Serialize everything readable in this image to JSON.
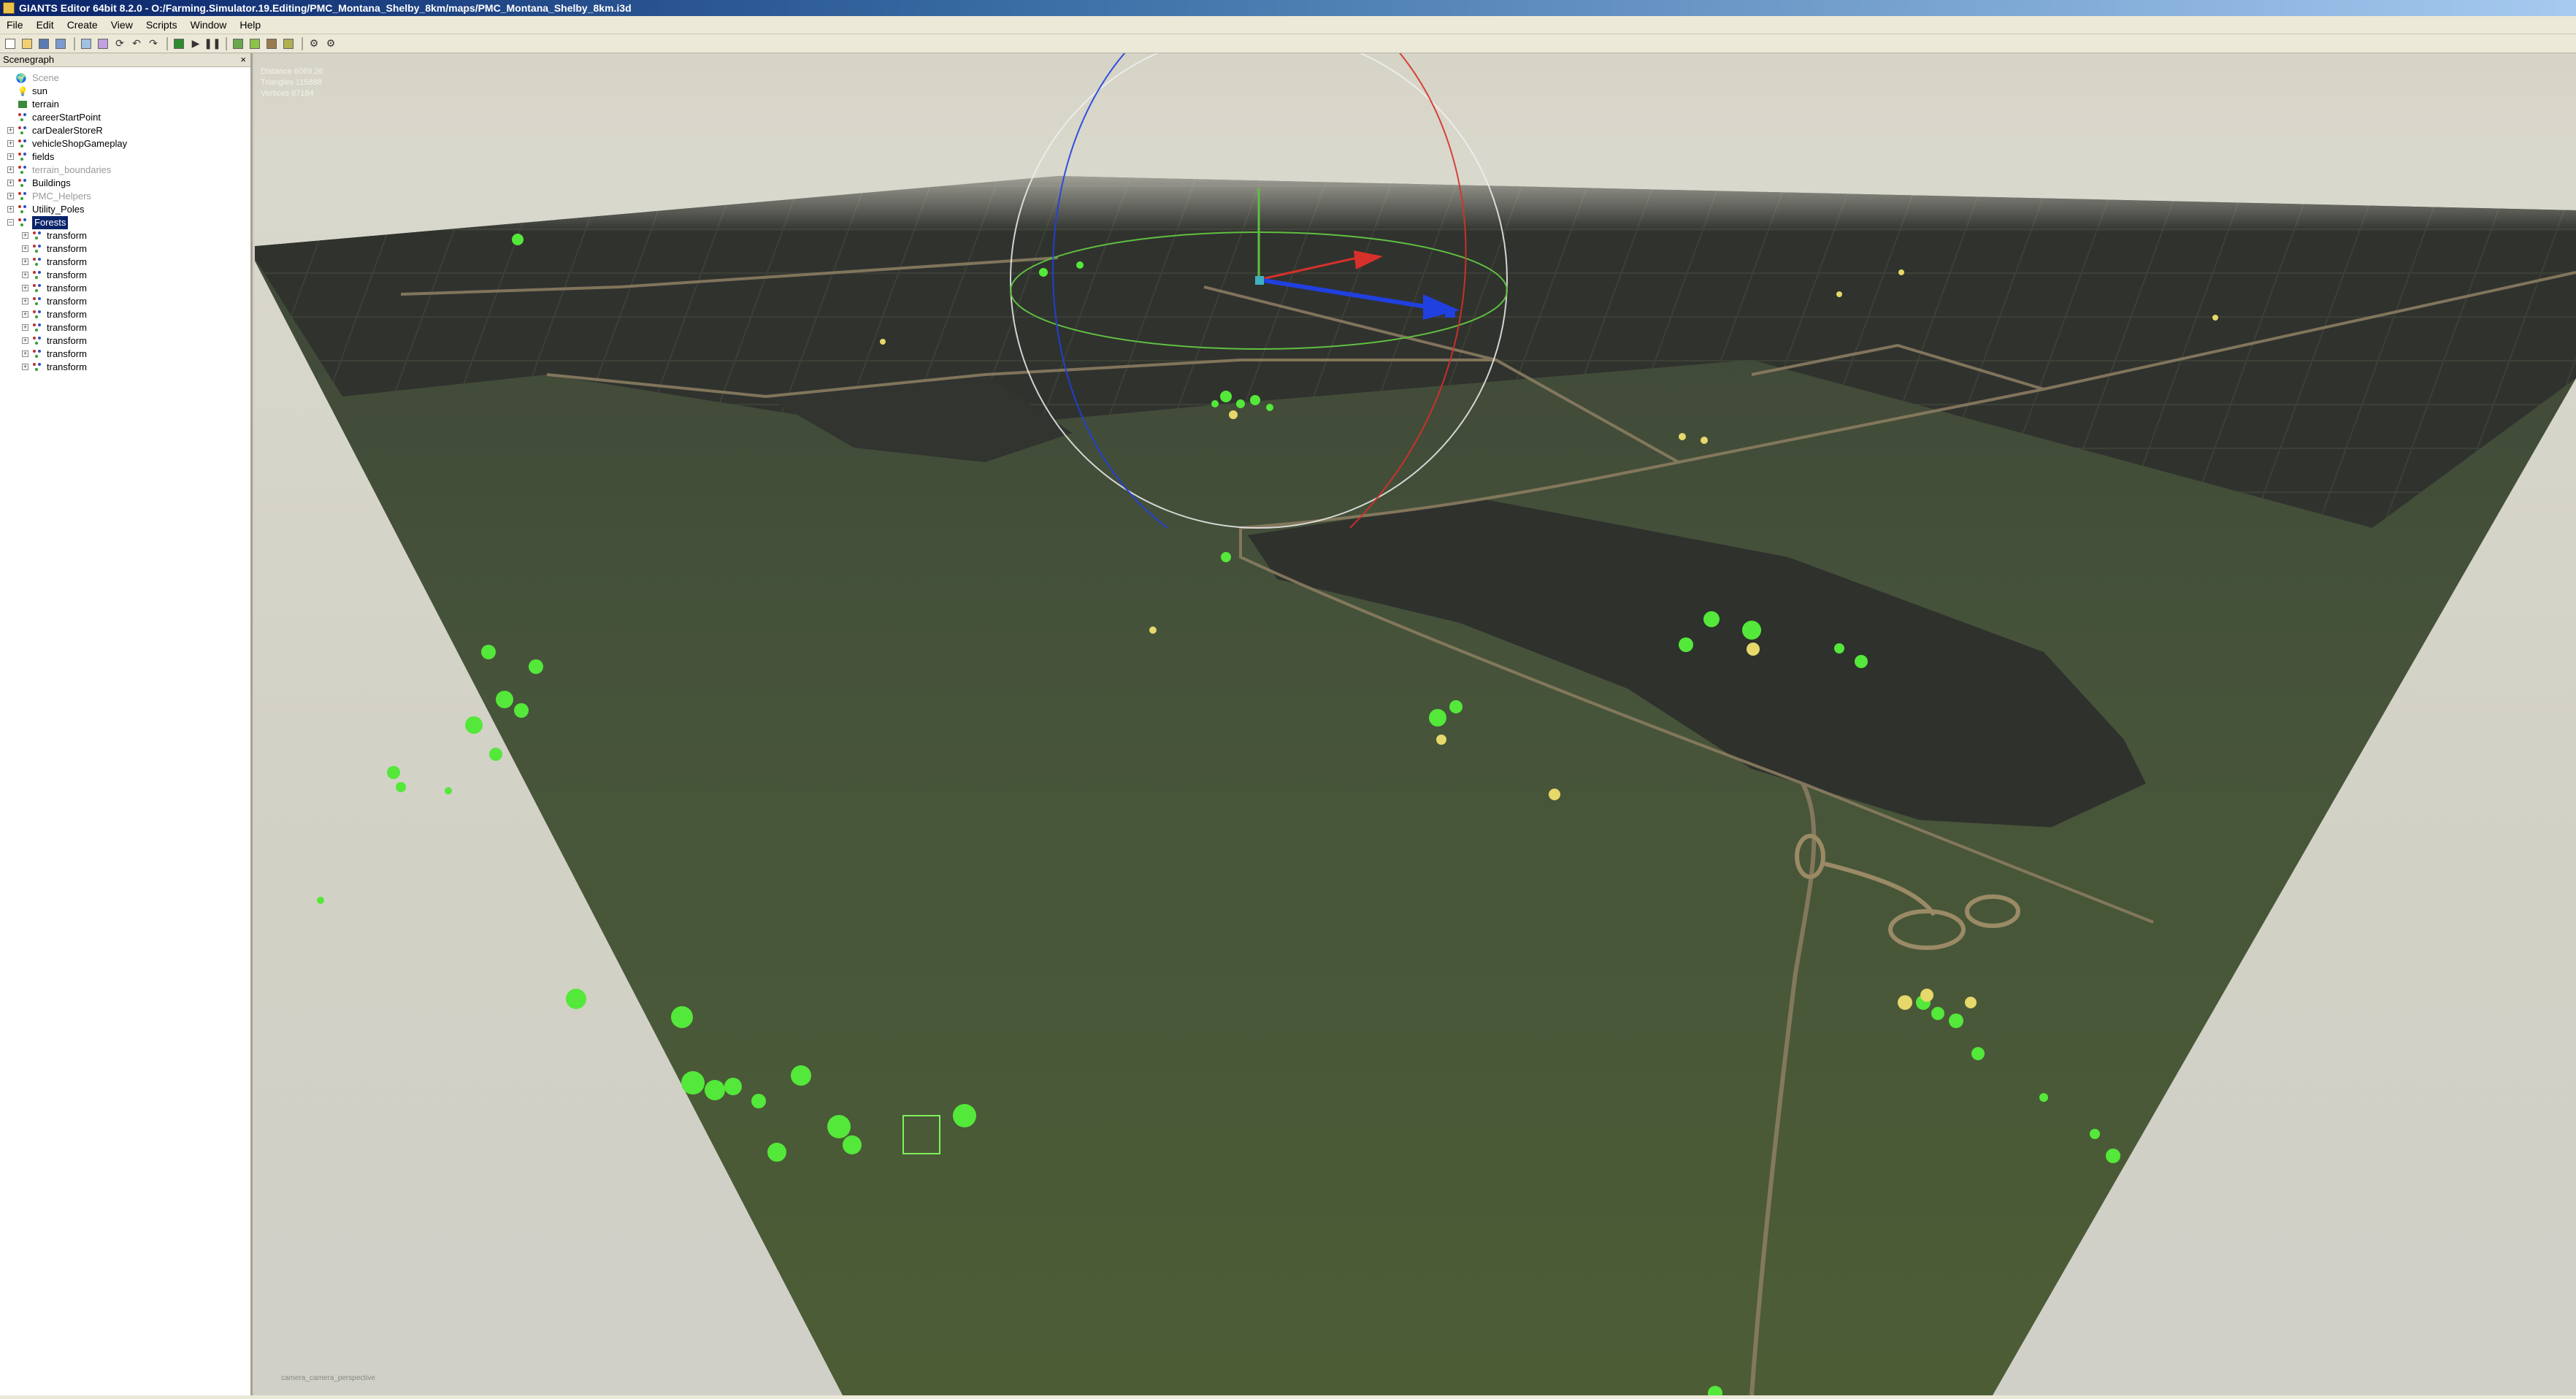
{
  "window": {
    "title": "GIANTS Editor 64bit 8.2.0 - O:/Farming.Simulator.19.Editing/PMC_Montana_Shelby_8km/maps/PMC_Montana_Shelby_8km.i3d"
  },
  "menu": {
    "items": [
      "File",
      "Edit",
      "Create",
      "View",
      "Scripts",
      "Window",
      "Help"
    ]
  },
  "toolbar": {
    "icons": [
      "new-file-icon",
      "open-icon",
      "save-icon",
      "save-as-icon",
      "import-icon",
      "export-icon",
      "reload-icon",
      "undo-icon",
      "redo-icon",
      "play-icon",
      "pause-icon",
      "terrain-icon",
      "paint-icon",
      "foliage-icon",
      "settings-icon",
      "camera-icon"
    ]
  },
  "scenegraph": {
    "title": "Scenegraph",
    "close": "×",
    "root": "Scene",
    "nodes": [
      {
        "label": "sun",
        "depth": 1,
        "expander": "",
        "icon": "light-icon",
        "dim": false
      },
      {
        "label": "terrain",
        "depth": 1,
        "expander": "",
        "icon": "terrain-icon",
        "dim": false
      },
      {
        "label": "careerStartPoint",
        "depth": 1,
        "expander": "",
        "icon": "transform-icon",
        "dim": false
      },
      {
        "label": "carDealerStoreR",
        "depth": 1,
        "expander": "+",
        "icon": "transform-icon",
        "dim": false
      },
      {
        "label": "vehicleShopGameplay",
        "depth": 1,
        "expander": "+",
        "icon": "transform-icon",
        "dim": false
      },
      {
        "label": "fields",
        "depth": 1,
        "expander": "+",
        "icon": "transform-icon",
        "dim": false
      },
      {
        "label": "terrain_boundaries",
        "depth": 1,
        "expander": "+",
        "icon": "transform-icon",
        "dim": true
      },
      {
        "label": "Buildings",
        "depth": 1,
        "expander": "+",
        "icon": "transform-icon",
        "dim": false
      },
      {
        "label": "PMC_Helpers",
        "depth": 1,
        "expander": "+",
        "icon": "transform-icon",
        "dim": true
      },
      {
        "label": "Utility_Poles",
        "depth": 1,
        "expander": "+",
        "icon": "transform-icon",
        "dim": false
      },
      {
        "label": "Forests",
        "depth": 1,
        "expander": "−",
        "icon": "transform-icon",
        "dim": false,
        "selected": true
      },
      {
        "label": "transform",
        "depth": 2,
        "expander": "+",
        "icon": "transform-icon",
        "dim": false
      },
      {
        "label": "transform",
        "depth": 2,
        "expander": "+",
        "icon": "transform-icon",
        "dim": false
      },
      {
        "label": "transform",
        "depth": 2,
        "expander": "+",
        "icon": "transform-icon",
        "dim": false
      },
      {
        "label": "transform",
        "depth": 2,
        "expander": "+",
        "icon": "transform-icon",
        "dim": false
      },
      {
        "label": "transform",
        "depth": 2,
        "expander": "+",
        "icon": "transform-icon",
        "dim": false
      },
      {
        "label": "transform",
        "depth": 2,
        "expander": "+",
        "icon": "transform-icon",
        "dim": false
      },
      {
        "label": "transform",
        "depth": 2,
        "expander": "+",
        "icon": "transform-icon",
        "dim": false
      },
      {
        "label": "transform",
        "depth": 2,
        "expander": "+",
        "icon": "transform-icon",
        "dim": false
      },
      {
        "label": "transform",
        "depth": 2,
        "expander": "+",
        "icon": "transform-icon",
        "dim": false
      },
      {
        "label": "transform",
        "depth": 2,
        "expander": "+",
        "icon": "transform-icon",
        "dim": false
      },
      {
        "label": "transform",
        "depth": 2,
        "expander": "+",
        "icon": "transform-icon",
        "dim": false
      }
    ]
  },
  "viewport": {
    "stats": {
      "distance": "Distance 6069.26",
      "triangles": "Triangles 115888",
      "vertices": "Vertices 87184"
    },
    "camera_label": "camera_camera_perspective"
  },
  "colors": {
    "terrain_grass": "#4a5a32",
    "field_dark": "#2e302c",
    "road": "#8a7c60",
    "tree_selected": "#54e83a",
    "gizmo_x": "#d8302a",
    "gizmo_y": "#60c040",
    "gizmo_z": "#2040e0"
  }
}
